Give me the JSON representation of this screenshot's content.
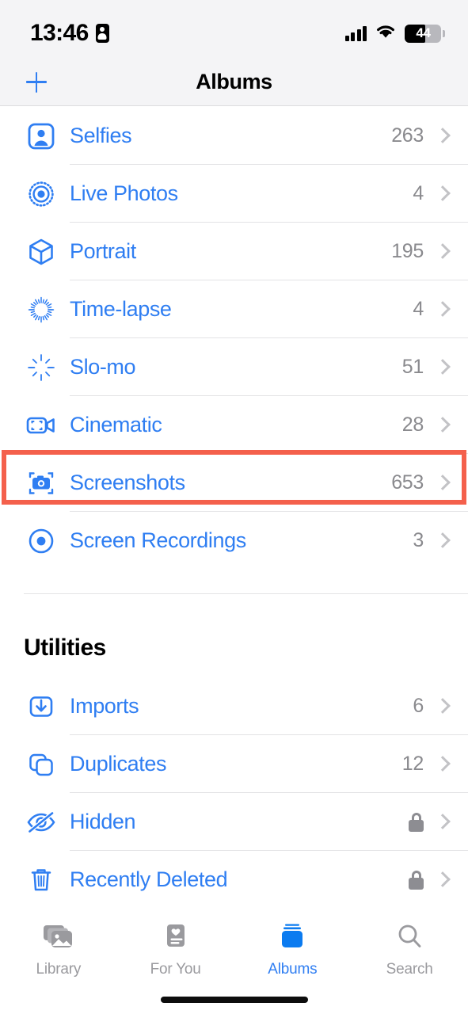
{
  "status_bar": {
    "time": "13:46",
    "id_icon": "person-badge-icon",
    "signal_icon": "cellular-signal-icon",
    "wifi_icon": "wifi-icon",
    "battery_level": "44",
    "battery_percent": 44
  },
  "nav_bar": {
    "add_label": "+",
    "title": "Albums"
  },
  "media_types": {
    "rows": [
      {
        "label": "Selfies",
        "count": "263",
        "icon": "person-square-icon"
      },
      {
        "label": "Live Photos",
        "count": "4",
        "icon": "live-photo-icon"
      },
      {
        "label": "Portrait",
        "count": "195",
        "icon": "cube-icon"
      },
      {
        "label": "Time-lapse",
        "count": "4",
        "icon": "timelapse-icon"
      },
      {
        "label": "Slo-mo",
        "count": "51",
        "icon": "slomo-icon"
      },
      {
        "label": "Cinematic",
        "count": "28",
        "icon": "cinematic-video-icon"
      },
      {
        "label": "Screenshots",
        "count": "653",
        "icon": "screenshot-camera-icon"
      },
      {
        "label": "Screen Recordings",
        "count": "3",
        "icon": "screen-record-icon"
      }
    ]
  },
  "utilities": {
    "header": "Utilities",
    "rows": [
      {
        "label": "Imports",
        "count": "6",
        "icon": "import-tray-icon",
        "locked": false
      },
      {
        "label": "Duplicates",
        "count": "12",
        "icon": "duplicates-icon",
        "locked": false
      },
      {
        "label": "Hidden",
        "count": "",
        "icon": "eye-slash-icon",
        "locked": true
      },
      {
        "label": "Recently Deleted",
        "count": "",
        "icon": "trash-icon",
        "locked": true
      }
    ]
  },
  "highlight": {
    "target_label": "Screenshots",
    "color": "#f4604c"
  },
  "tab_bar": {
    "tabs": [
      {
        "label": "Library",
        "icon": "photo-stack-icon",
        "active": false
      },
      {
        "label": "For You",
        "icon": "heart-card-icon",
        "active": false
      },
      {
        "label": "Albums",
        "icon": "albums-icon",
        "active": true
      },
      {
        "label": "Search",
        "icon": "search-icon",
        "active": false
      }
    ]
  },
  "colors": {
    "accent_blue": "#2f7ef2",
    "count_gray": "#8a8a8e",
    "chevron_gray": "#c3c3c6",
    "highlight_red": "#f4604c"
  }
}
